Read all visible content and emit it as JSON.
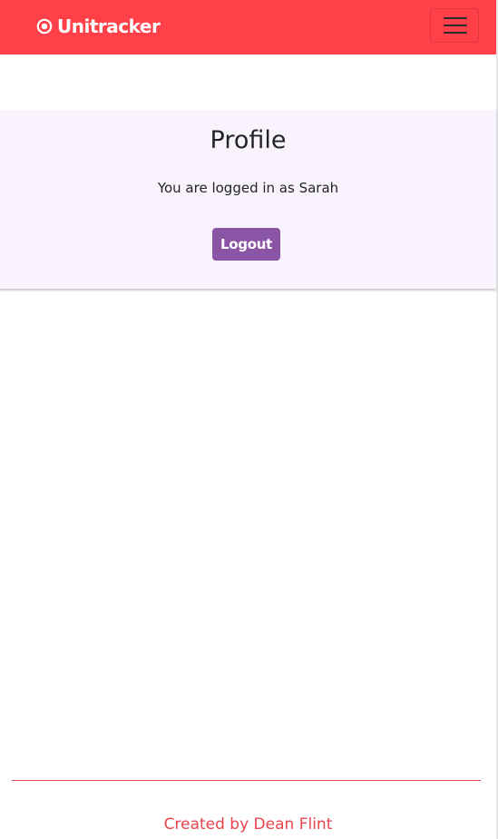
{
  "navbar": {
    "brand": "Unitracker",
    "brand_icon": "target-circle-icon",
    "toggler_icon": "hamburger-menu-icon",
    "background": "#ff4048"
  },
  "profile": {
    "title": "Profile",
    "status_text": "You are logged in as Sarah",
    "logout_label": "Logout",
    "card_background": "#f9f3fd",
    "button_color": "#8b55a6"
  },
  "footer": {
    "credit": "Created by Dean Flint",
    "color": "#e8444c"
  }
}
